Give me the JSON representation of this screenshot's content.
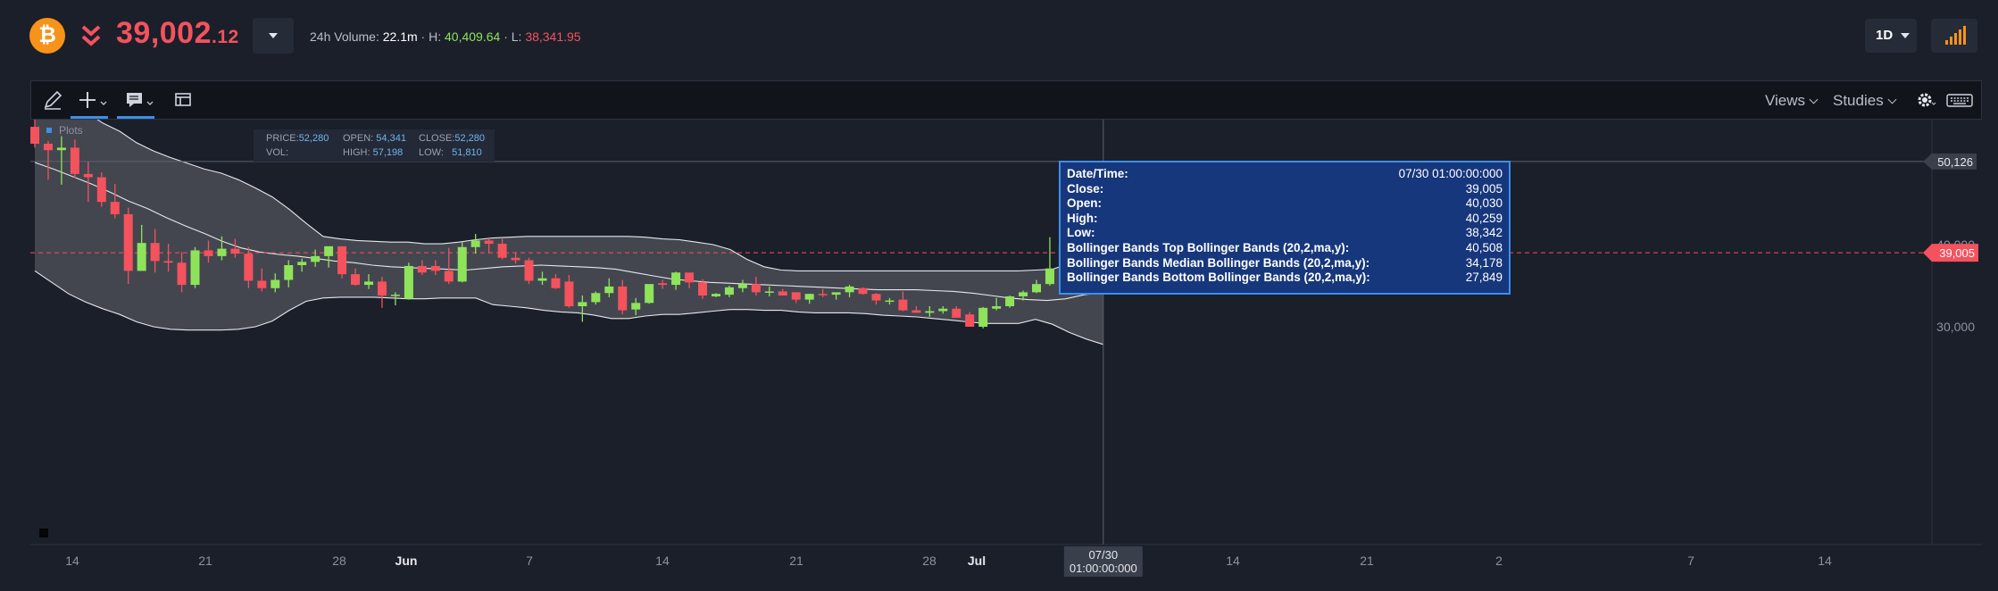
{
  "header": {
    "coin_icon": "bitcoin-icon",
    "trend_icon": "double-chevron-down-icon",
    "price_main": "39,002",
    "price_decimal": ".12",
    "volume_label": "24h Volume:",
    "volume_value": "22.1m",
    "high_label": "· H:",
    "high_value": "40,409.64",
    "low_label": "· L:",
    "low_value": "38,341.95",
    "period": "1D",
    "signal_icon": "signal-bars-icon"
  },
  "toolbar": {
    "views_label": "Views",
    "studies_label": "Studies",
    "icons": [
      "pencil-icon",
      "crosshair-plus-icon",
      "comment-icon",
      "layout-icon",
      "gear-icon",
      "keyboard-icon"
    ]
  },
  "plots_label": "Plots",
  "info": {
    "price_label": "PRICE:",
    "price_value": "52,280",
    "open_label": "OPEN:",
    "open_value": "54,341",
    "close_label": "CLOSE:",
    "close_value": "52,280",
    "vol_label": "VOL:",
    "vol_value": "",
    "high_label": "HIGH:",
    "high_value": "57,198",
    "low_label": "LOW:",
    "low_value": "51,810"
  },
  "tooltip": {
    "rows": [
      {
        "key": "Date/Time:",
        "value": "07/30 01:00:00:000"
      },
      {
        "key": "Close:",
        "value": "39,005"
      },
      {
        "key": "Open:",
        "value": "40,030"
      },
      {
        "key": "High:",
        "value": "40,259"
      },
      {
        "key": "Low:",
        "value": "38,342"
      },
      {
        "key": "Bollinger Bands Top Bollinger Bands (20,2,ma,y):",
        "value": "40,508"
      },
      {
        "key": "Bollinger Bands Median Bollinger Bands (20,2,ma,y):",
        "value": "34,178"
      },
      {
        "key": "Bollinger Bands Bottom Bollinger Bands (20,2,ma,y):",
        "value": "27,849"
      }
    ]
  },
  "price_tags": {
    "crosshair": "50,126",
    "last": "39,005"
  },
  "crosshair_date": [
    "07/30",
    "01:00:00:000"
  ],
  "colors": {
    "up": "#8ee35b",
    "down": "#f4525d",
    "band_fill": "#4a4d56",
    "accent": "#3d8fe6"
  },
  "chart_data": {
    "type": "candlestick",
    "y_ticks": [
      "40,000",
      "30,000"
    ],
    "x_ticks": [
      "14",
      "21",
      "28",
      "Jun",
      "7",
      "14",
      "21",
      "28",
      "Jul",
      "7",
      "14",
      "21",
      "2",
      "7",
      "14"
    ],
    "ylim": [
      21000,
      54000
    ],
    "candles": [
      [
        54341,
        57198,
        51810,
        52280
      ],
      [
        52280,
        52600,
        47900,
        51500
      ],
      [
        51500,
        53200,
        47300,
        51800
      ],
      [
        51800,
        52800,
        48100,
        48600
      ],
      [
        48600,
        50100,
        45200,
        48200
      ],
      [
        48200,
        48800,
        44600,
        45200
      ],
      [
        45200,
        47400,
        43200,
        43700
      ],
      [
        43700,
        44500,
        35200,
        36800
      ],
      [
        36800,
        42400,
        37300,
        40200
      ],
      [
        40200,
        41900,
        36600,
        38000
      ],
      [
        38000,
        40100,
        36700,
        37800
      ],
      [
        37800,
        39100,
        34200,
        35100
      ],
      [
        35100,
        39700,
        34700,
        39300
      ],
      [
        39300,
        40500,
        37800,
        38600
      ],
      [
        38600,
        41000,
        38100,
        39500
      ],
      [
        39500,
        40700,
        38400,
        38900
      ],
      [
        38900,
        39700,
        34700,
        35600
      ],
      [
        35600,
        37100,
        34300,
        34700
      ],
      [
        34700,
        36500,
        34200,
        35700
      ],
      [
        35700,
        38100,
        34800,
        37500
      ],
      [
        37500,
        38300,
        36700,
        37900
      ],
      [
        37900,
        39400,
        37300,
        38600
      ],
      [
        38600,
        39700,
        37200,
        39800
      ],
      [
        39800,
        39100,
        35900,
        36400
      ],
      [
        36400,
        37100,
        35000,
        35100
      ],
      [
        35100,
        36400,
        34600,
        35500
      ],
      [
        35500,
        36100,
        32300,
        33800
      ],
      [
        33800,
        34200,
        32600,
        33900
      ],
      [
        33400,
        37800,
        33300,
        37400
      ],
      [
        37400,
        38100,
        36300,
        36600
      ],
      [
        37400,
        38100,
        36300,
        36800
      ],
      [
        36800,
        39600,
        35200,
        35500
      ],
      [
        35500,
        40300,
        35400,
        39700
      ],
      [
        39700,
        41300,
        38900,
        40500
      ],
      [
        40500,
        40900,
        38900,
        40100
      ],
      [
        40100,
        40700,
        38200,
        38400
      ],
      [
        38400,
        39100,
        37700,
        38100
      ],
      [
        38100,
        38400,
        35200,
        35600
      ],
      [
        35600,
        36700,
        35100,
        35900
      ],
      [
        35900,
        36400,
        34600,
        34700
      ],
      [
        35500,
        36300,
        32300,
        32500
      ],
      [
        32500,
        33800,
        30600,
        33000
      ],
      [
        33000,
        34300,
        32700,
        34100
      ],
      [
        34100,
        35900,
        33600,
        34900
      ],
      [
        34900,
        35700,
        31500,
        32000
      ],
      [
        32100,
        33500,
        31400,
        32900
      ],
      [
        32900,
        35100,
        32800,
        35200
      ],
      [
        35300,
        35700,
        34600,
        35100
      ],
      [
        35100,
        36700,
        34500,
        36600
      ],
      [
        36600,
        36100,
        34700,
        35400
      ],
      [
        35400,
        35800,
        33400,
        33800
      ],
      [
        33700,
        34100,
        33600,
        34000
      ],
      [
        33900,
        35000,
        33600,
        34800
      ],
      [
        34700,
        35700,
        34200,
        35200
      ],
      [
        35200,
        36100,
        33800,
        34200
      ],
      [
        34200,
        34900,
        33700,
        34300
      ],
      [
        34300,
        34600,
        34000,
        33800
      ],
      [
        34200,
        34200,
        32900,
        33300
      ],
      [
        33300,
        34000,
        32800,
        34000
      ],
      [
        34000,
        34600,
        33600,
        33900
      ],
      [
        33900,
        34100,
        33300,
        34200
      ],
      [
        34200,
        35100,
        33600,
        34900
      ],
      [
        34700,
        34800,
        33900,
        34000
      ],
      [
        34000,
        34100,
        32700,
        33200
      ],
      [
        33200,
        33500,
        32700,
        33200
      ],
      [
        33300,
        34300,
        31900,
        32000
      ],
      [
        32000,
        32500,
        31700,
        31700
      ],
      [
        31700,
        32500,
        31200,
        31900
      ],
      [
        31900,
        32500,
        31600,
        32200
      ],
      [
        32200,
        32500,
        31500,
        31100
      ],
      [
        31500,
        31800,
        30000,
        30000
      ],
      [
        30000,
        32400,
        29800,
        32300
      ],
      [
        32200,
        33500,
        32000,
        32500
      ],
      [
        32500,
        33800,
        32300,
        33700
      ],
      [
        33700,
        34400,
        33200,
        34200
      ],
      [
        34200,
        35700,
        34100,
        35200
      ],
      [
        35200,
        40900,
        35000,
        37100
      ],
      [
        37100,
        40400,
        37200,
        39900
      ],
      [
        39900,
        40800,
        39600,
        40300
      ],
      [
        40100,
        40700,
        39800,
        40200
      ],
      [
        40030,
        40259,
        38342,
        39005
      ]
    ],
    "bollinger_upper": [
      63000,
      60000,
      57500,
      56200,
      54800,
      53800,
      52400,
      51400,
      50600,
      49900,
      49200,
      48700,
      47900,
      46900,
      45800,
      44300,
      42600,
      41000,
      40700,
      40500,
      40400,
      40300,
      40300,
      40100,
      40100,
      40300,
      40600,
      40800,
      40900,
      41000,
      41000,
      41000,
      41000,
      41000,
      41000,
      41000,
      40900,
      40700,
      40600,
      40300,
      40000,
      39400,
      38200,
      37300,
      36900,
      36800,
      36800,
      36800,
      36800,
      36800,
      36800,
      36800,
      36800,
      36800,
      36800,
      36800,
      36800,
      36800,
      36800,
      36900,
      37000,
      37700,
      39000,
      40500
    ],
    "bollinger_middle": [
      50000,
      49200,
      48300,
      47400,
      46400,
      45300,
      44400,
      43300,
      42300,
      41400,
      40400,
      39600,
      39100,
      38800,
      38600,
      38300,
      38000,
      37800,
      37500,
      37300,
      37200,
      37100,
      37000,
      36900,
      37100,
      37300,
      37400,
      37500,
      37400,
      37300,
      37200,
      37000,
      36600,
      36200,
      35800,
      35600,
      35400,
      35300,
      35200,
      35100,
      35000,
      34900,
      34800,
      34700,
      34600,
      34500,
      34500,
      34500,
      34400,
      34300,
      34100,
      33800,
      33500,
      33300,
      33200,
      33400,
      33900,
      34200
    ],
    "bollinger_lower": [
      36800,
      35400,
      34000,
      33000,
      32200,
      31500,
      30600,
      30000,
      29700,
      29600,
      29600,
      29600,
      29700,
      30000,
      30700,
      32000,
      33100,
      33500,
      33600,
      33600,
      33600,
      33500,
      33400,
      33400,
      33500,
      33500,
      33500,
      32700,
      32500,
      32300,
      32000,
      31800,
      31700,
      31400,
      31000,
      31000,
      31300,
      31500,
      31500,
      31700,
      31900,
      32100,
      32100,
      32000,
      32000,
      31800,
      31700,
      31700,
      31700,
      31600,
      31400,
      31300,
      31200,
      31000,
      30800,
      30600,
      30400,
      30400,
      30400,
      30900,
      30300,
      29300,
      28500,
      27849
    ]
  }
}
